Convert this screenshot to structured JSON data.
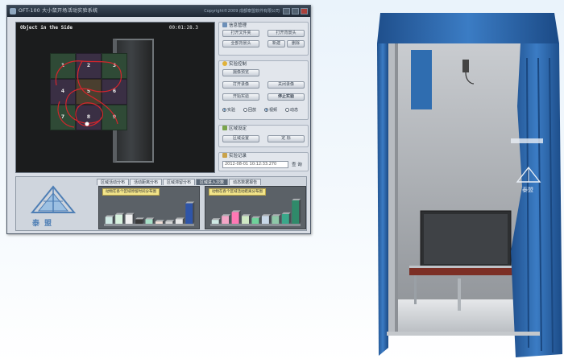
{
  "window": {
    "title": "OFT-100 大小鼠开场活动实验系统",
    "copyright": "Copyright©2009 成都泰盟软件有限公司"
  },
  "video": {
    "label": "Object in the Side",
    "timer": "00:01:28.3",
    "zones": [
      "1",
      "2",
      "3",
      "4",
      "5",
      "6",
      "7",
      "8",
      "9"
    ]
  },
  "panel": {
    "groups": [
      {
        "title": "信息管理",
        "buttons": [
          "打开文件夹",
          "打开背景头",
          "全部背景头",
          "新建",
          "删除"
        ]
      },
      {
        "title": "实验控制",
        "buttons": [
          "摄像预览",
          "打开录像",
          "关闭录像",
          "开始实验",
          "停止实验"
        ],
        "radios": [
          "实验",
          "回放",
          "视频",
          "动态"
        ]
      },
      {
        "title": "区域设定",
        "buttons": [
          "区域设置",
          "定 标"
        ]
      },
      {
        "title": "实验记录",
        "date": "2012-08-01 10:12:33.270",
        "query": "查 询"
      }
    ]
  },
  "bottom": {
    "logo_text": "泰盟",
    "tabs": [
      "区域活动分布",
      "活动距离分布",
      "区域滞留分布",
      "区域进入次数",
      "动态数据报告"
    ],
    "active_tab_index": 3,
    "chart_titles": [
      "动物在各个区域停留时间分布图",
      "动物在各个区域活动距离分布图"
    ]
  },
  "chart_data": [
    {
      "type": "bar",
      "title": "动物在各个区域停留时间分布图",
      "categories": [
        "1",
        "2",
        "3",
        "4",
        "5",
        "6",
        "7",
        "8",
        "9"
      ],
      "values": [
        3,
        4,
        4,
        2,
        2,
        1,
        1,
        2,
        9
      ],
      "ylim": [
        0,
        12
      ]
    },
    {
      "type": "bar",
      "title": "动物在各个区域活动距离分布图",
      "categories": [
        "1",
        "2",
        "3",
        "4",
        "5",
        "6",
        "7",
        "8",
        "9"
      ],
      "values": [
        2,
        4,
        6,
        4,
        3,
        4,
        4,
        5,
        12
      ],
      "ylim": [
        0,
        14
      ]
    }
  ],
  "colors": {
    "accent": "#2f6db0",
    "tent": "#2d64a8",
    "bars": [
      "#cfe9e4",
      "#d7f2de",
      "#f0f0f0",
      "#3a3a3a",
      "#a8e0c8",
      "#f2e0d8",
      "#d6d6d6",
      "#e8e8e8",
      "#2f55a8"
    ],
    "bars2": [
      "#cfe9e4",
      "#f4a6c7",
      "#ff78b4",
      "#cfe9c4",
      "#6fd29a",
      "#c8d8e8",
      "#8ec8a8",
      "#3aa88a",
      "#2f8a6a"
    ]
  },
  "product": {
    "logo_text": "泰盟"
  }
}
